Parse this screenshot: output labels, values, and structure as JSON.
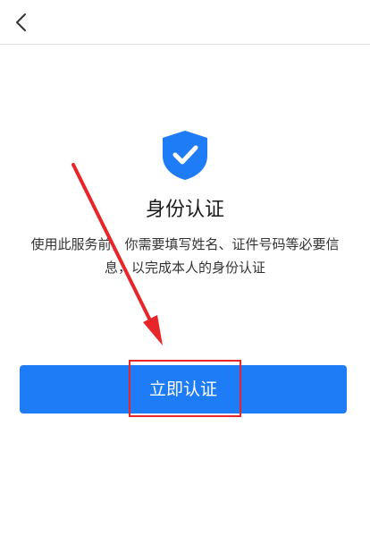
{
  "nav": {
    "back_icon": "chevron-left-icon"
  },
  "main": {
    "icon": "shield-check-icon",
    "title": "身份认证",
    "description": "使用此服务前，你需要填写姓名、证件号码等必要信息，以完成本人的身份认证",
    "confirm_label": "立即认证"
  },
  "colors": {
    "accent": "#1e7cf7",
    "annotation": "#e8262a"
  }
}
